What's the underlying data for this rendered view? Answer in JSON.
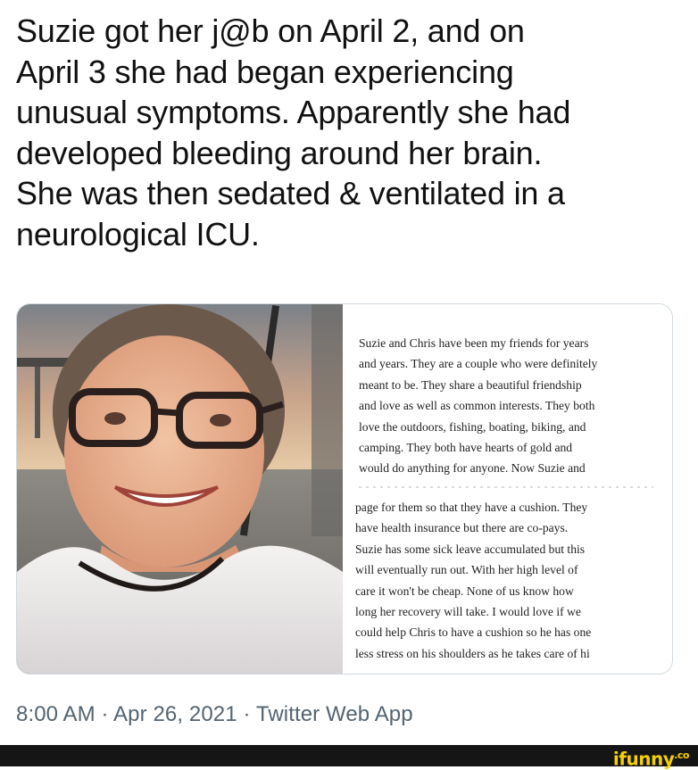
{
  "tweet": {
    "lines": [
      "Suzie got her j@b on April 2, and on",
      "April 3 she had began experiencing",
      "unusual symptoms. Apparently she had",
      "developed bleeding around her brain.",
      "She was then sedated & ventilated in a",
      "neurological ICU."
    ],
    "timestamp": "8:00 AM · Apr 26, 2021 · Twitter Web App"
  },
  "card": {
    "photo_icon": "woman-selfie-photo",
    "article_para1": [
      "Suzie and Chris have been my friends for years",
      "and years.  They are a couple who were definitely",
      "meant to be.  They share a beautiful friendship",
      "and love as well as common interests.  They both",
      "love the outdoors, fishing, boating, biking, and",
      "camping.  They both have hearts of gold and",
      "would do anything for anyone.  Now Suzie and"
    ],
    "article_para2": [
      "page for them so that they have a cushion.  They",
      "have health insurance but there are co-pays.",
      "Suzie has some sick leave accumulated but this",
      "will eventually run out.  With her high level of",
      "care it won't be cheap.  None of us know how",
      "long her recovery will take.  I would love if we",
      "could help Chris to have a cushion so he has one",
      "less stress on his shoulders as he takes care of hi"
    ]
  },
  "footer": {
    "brand": "ifunny",
    "brand_suffix": ".co",
    "brand_color": "#f5d000"
  }
}
